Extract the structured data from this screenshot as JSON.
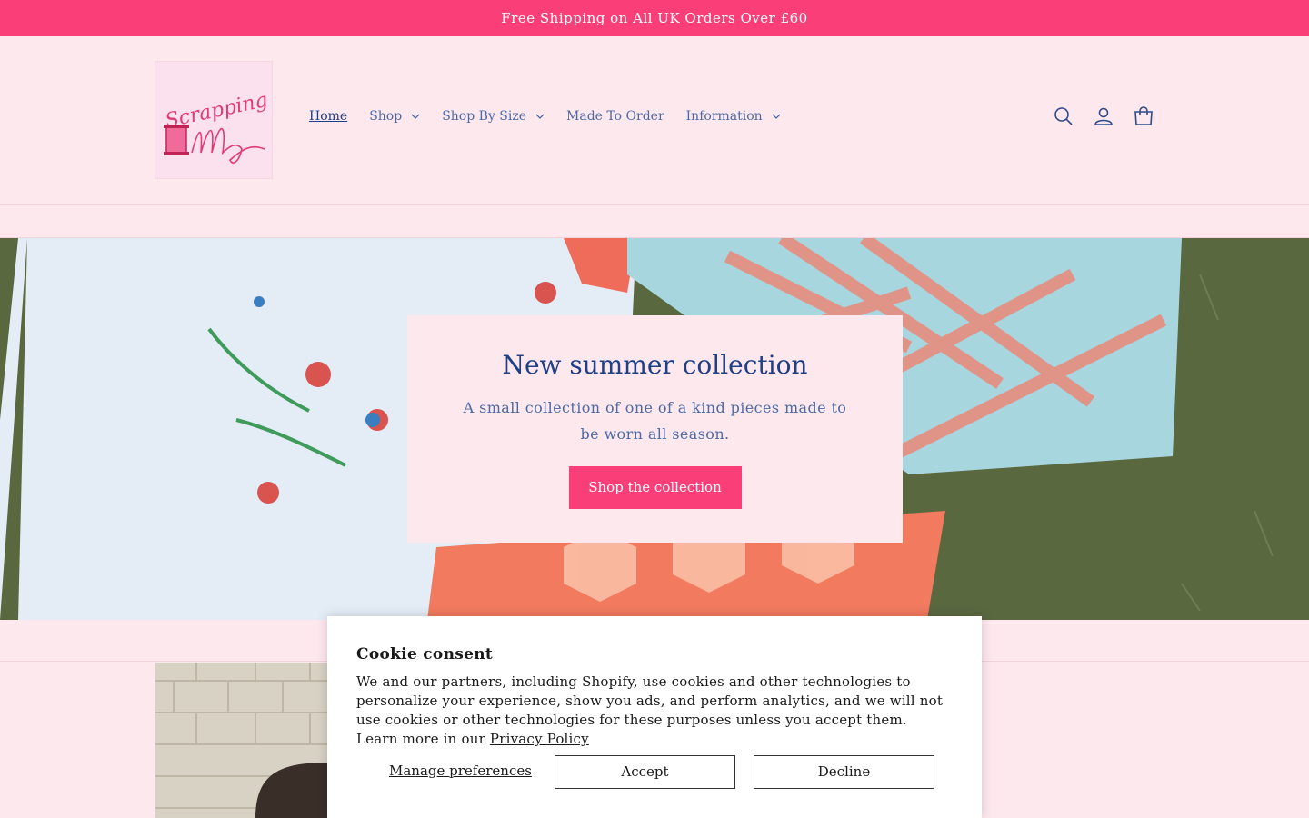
{
  "announcement": {
    "text": "Free Shipping on All UK Orders Over £60"
  },
  "header": {
    "logo_text": "Scrapping Elly",
    "nav": [
      {
        "label": "Home",
        "active": true,
        "dropdown": false
      },
      {
        "label": "Shop",
        "active": false,
        "dropdown": true
      },
      {
        "label": "Shop By Size",
        "active": false,
        "dropdown": true
      },
      {
        "label": "Made To Order",
        "active": false,
        "dropdown": false
      },
      {
        "label": "Information",
        "active": false,
        "dropdown": true
      }
    ],
    "icons": [
      "search-icon",
      "account-icon",
      "cart-icon"
    ]
  },
  "hero": {
    "title": "New summer collection",
    "subtitle": "A small collection of one of a kind pieces made to be worn all season.",
    "button": "Shop the collection"
  },
  "cookie": {
    "title": "Cookie consent",
    "text": "We and our partners, including Shopify, use cookies and other technologies to personalize your experience, show you ads, and perform analytics, and we will not use cookies or other technologies for these purposes unless you accept them. Learn more in our",
    "policy_link": "Privacy Policy",
    "manage": "Manage preferences",
    "accept": "Accept",
    "decline": "Decline"
  },
  "colors": {
    "accent": "#fa3f78",
    "background": "#fde8ee",
    "text": "#2e4a8a"
  }
}
